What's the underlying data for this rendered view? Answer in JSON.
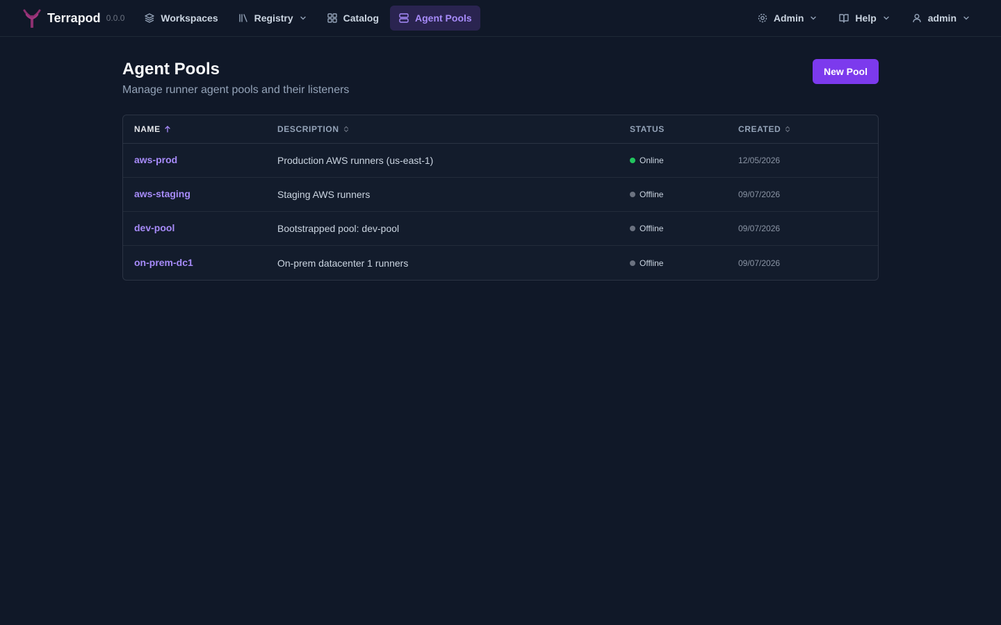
{
  "app": {
    "name": "Terrapod",
    "version": "0.0.0"
  },
  "nav": {
    "items": [
      {
        "label": "Workspaces",
        "icon": "layers-icon"
      },
      {
        "label": "Registry",
        "icon": "library-icon"
      },
      {
        "label": "Catalog",
        "icon": "grid-icon"
      },
      {
        "label": "Agent Pools",
        "icon": "server-icon",
        "active": true
      }
    ],
    "right": [
      {
        "label": "Admin",
        "icon": "gear-icon"
      },
      {
        "label": "Help",
        "icon": "book-icon"
      },
      {
        "label": "admin",
        "icon": "user-icon"
      }
    ]
  },
  "page": {
    "title": "Agent Pools",
    "subtitle": "Manage runner agent pools and their listeners",
    "new_button": "New Pool"
  },
  "table": {
    "columns": [
      "NAME",
      "DESCRIPTION",
      "STATUS",
      "CREATED"
    ],
    "rows": [
      {
        "name": "aws-prod",
        "description": "Production AWS runners (us-east-1)",
        "status": "Online",
        "created": "12/05/2026"
      },
      {
        "name": "aws-staging",
        "description": "Staging AWS runners",
        "status": "Offline",
        "created": "09/07/2026"
      },
      {
        "name": "dev-pool",
        "description": "Bootstrapped pool: dev-pool",
        "status": "Offline",
        "created": "09/07/2026"
      },
      {
        "name": "on-prem-dc1",
        "description": "On-prem datacenter 1 runners",
        "status": "Offline",
        "created": "09/07/2026"
      }
    ]
  },
  "colors": {
    "background": "#101828",
    "accent": "#7c3aed",
    "link": "#a78bfa",
    "online": "#22c55e",
    "offline": "#6b7280"
  }
}
